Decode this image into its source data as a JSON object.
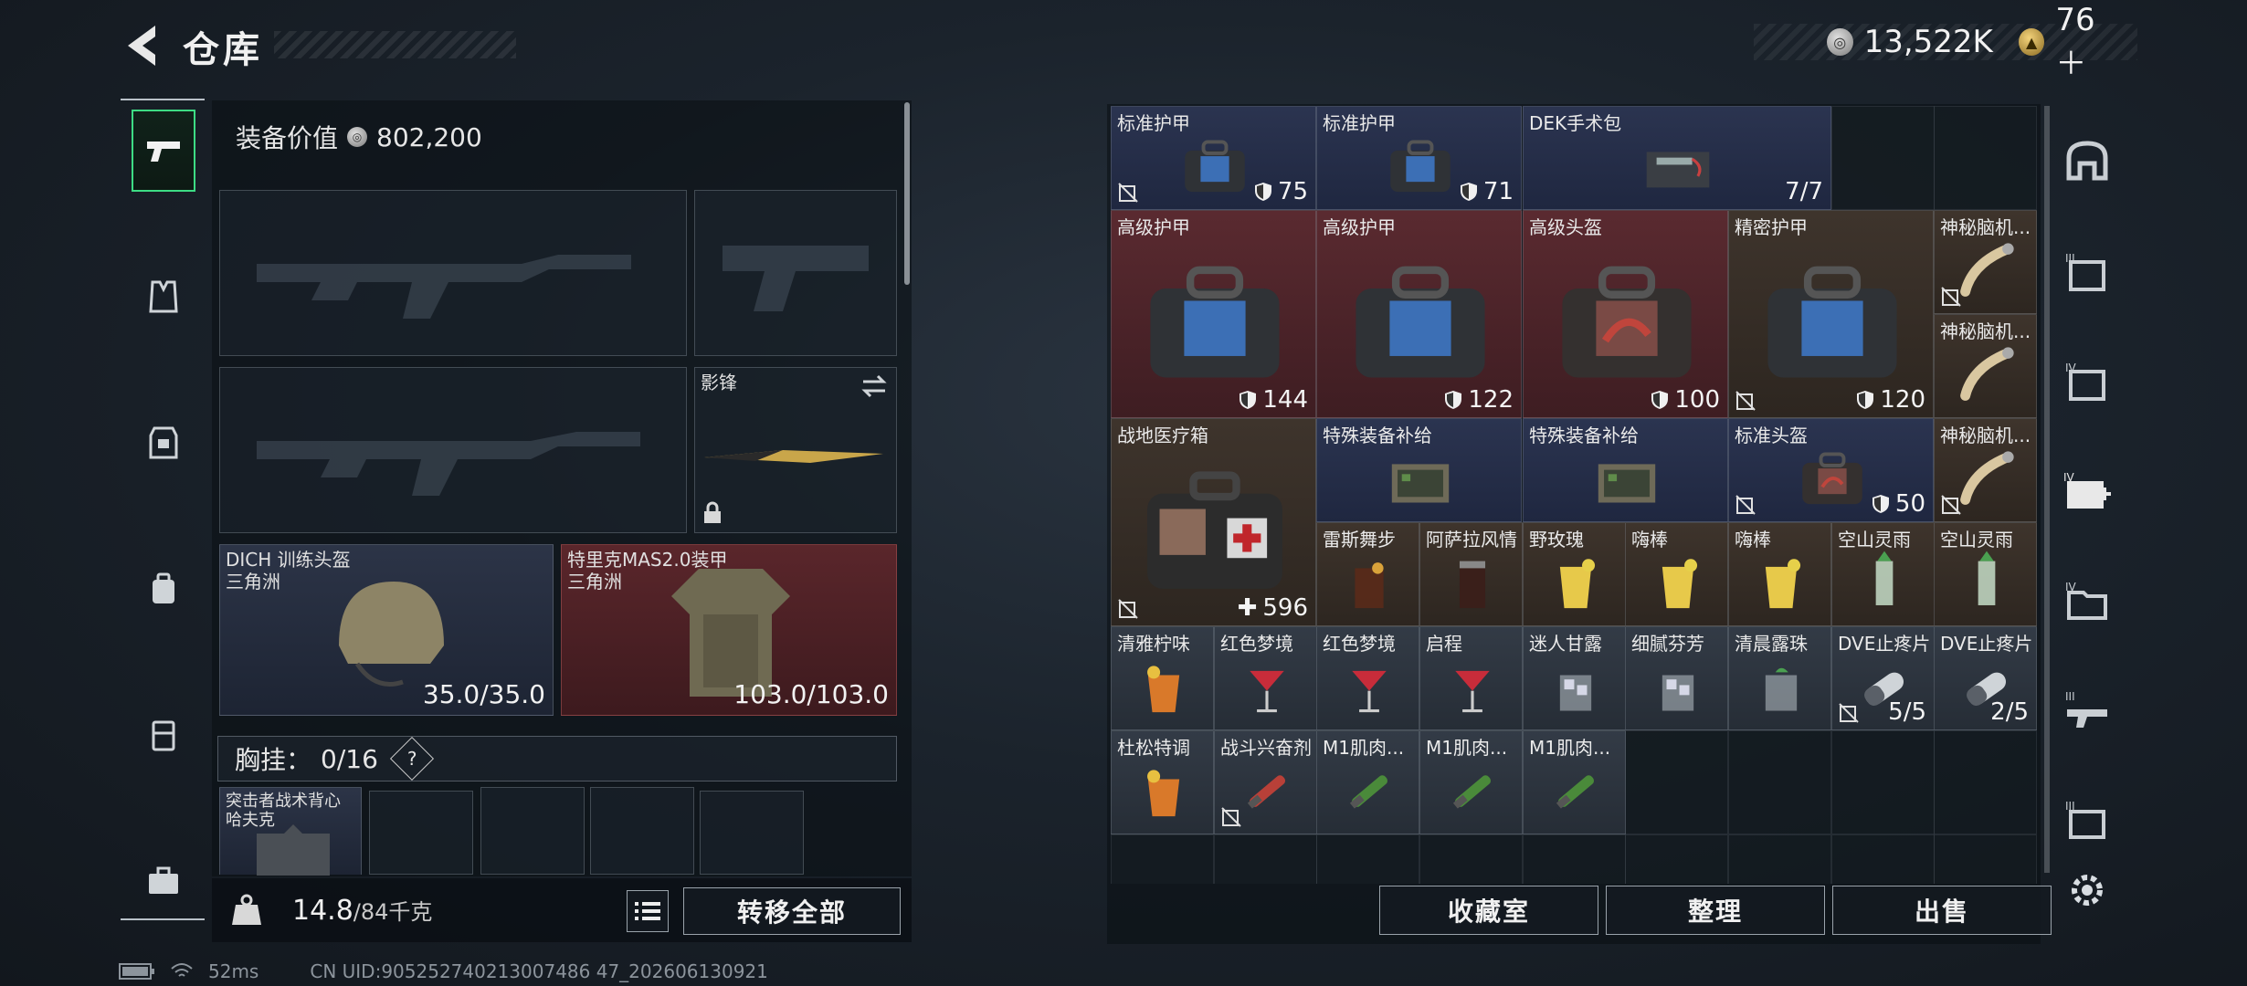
{
  "header": {
    "title": "仓库",
    "currency_1": "13,522K",
    "currency_2": "76＋"
  },
  "left_nav": [
    "pistol-icon",
    "vest-icon",
    "armor-icon",
    "backpack-icon",
    "rig-icon",
    "briefcase-icon"
  ],
  "equipment": {
    "value_label": "装备价值",
    "value": "802,200",
    "melee_name": "影锋",
    "helmet_name": "DICH 训练头盔",
    "helmet_sub": "三角洲",
    "helmet_durability": "35.0/35.0",
    "armor_name": "特里克MAS2.0装甲",
    "armor_sub": "三角洲",
    "armor_durability": "103.0/103.0",
    "chest_label": "胸挂：",
    "chest_count": "0/16",
    "chest_help": "?",
    "rig_name": "突击者战术背心",
    "rig_sub": "哈夫克"
  },
  "weight": {
    "current": "14.8",
    "max": "/84千克"
  },
  "buttons": {
    "transfer_all": "转移全部",
    "collection": "收藏室",
    "organize": "整理",
    "sell": "出售"
  },
  "storage": {
    "items": [
      {
        "name": "标准护甲",
        "value": "75"
      },
      {
        "name": "标准护甲",
        "value": "71"
      },
      {
        "name": "DEK手术包",
        "value": "7/7"
      },
      {
        "name": "高级护甲",
        "value": "144"
      },
      {
        "name": "高级护甲",
        "value": "122"
      },
      {
        "name": "高级头盔",
        "value": "100"
      },
      {
        "name": "精密护甲",
        "value": "120"
      },
      {
        "name": "神秘脑机...",
        "value": ""
      },
      {
        "name": "神秘脑机...",
        "value": ""
      },
      {
        "name": "战地医疗箱",
        "value": "596"
      },
      {
        "name": "特殊装备补给",
        "value": ""
      },
      {
        "name": "特殊装备补给",
        "value": ""
      },
      {
        "name": "标准头盔",
        "value": "50"
      },
      {
        "name": "神秘脑机...",
        "value": ""
      },
      {
        "name": "雷斯舞步",
        "value": ""
      },
      {
        "name": "阿萨拉风情",
        "value": ""
      },
      {
        "name": "野玫瑰",
        "value": ""
      },
      {
        "name": "嗨棒",
        "value": ""
      },
      {
        "name": "嗨棒",
        "value": ""
      },
      {
        "name": "空山灵雨",
        "value": ""
      },
      {
        "name": "空山灵雨",
        "value": ""
      },
      {
        "name": "清雅柠味",
        "value": ""
      },
      {
        "name": "红色梦境",
        "value": ""
      },
      {
        "name": "红色梦境",
        "value": ""
      },
      {
        "name": "启程",
        "value": ""
      },
      {
        "name": "迷人甘露",
        "value": ""
      },
      {
        "name": "细腻芬芳",
        "value": ""
      },
      {
        "name": "清晨露珠",
        "value": ""
      },
      {
        "name": "DVE止疼片",
        "value": "5/5"
      },
      {
        "name": "DVE止疼片",
        "value": "2/5"
      },
      {
        "name": "杜松特调",
        "value": ""
      },
      {
        "name": "战斗兴奋剂",
        "value": ""
      },
      {
        "name": "M1肌肉...",
        "value": ""
      },
      {
        "name": "M1肌肉...",
        "value": ""
      },
      {
        "name": "M1肌肉...",
        "value": ""
      }
    ]
  },
  "right_nav": [
    "bunker-icon",
    "storage-tier-3-icon",
    "storage-tier-4-icon",
    "storage-tier-4-medical-icon",
    "storage-tier-4-folder-icon",
    "storage-tier-3-weapon-icon",
    "storage-tier-3-box-icon",
    "settings-icon"
  ],
  "status": {
    "ping": "52ms",
    "uid": "CN UID:905252740213007486 47_202606130921"
  },
  "colors": {
    "accent_green": "#3ddc84",
    "item_red": "#5a2a30",
    "item_navy": "#2b3450",
    "item_brown": "#3e342c"
  }
}
